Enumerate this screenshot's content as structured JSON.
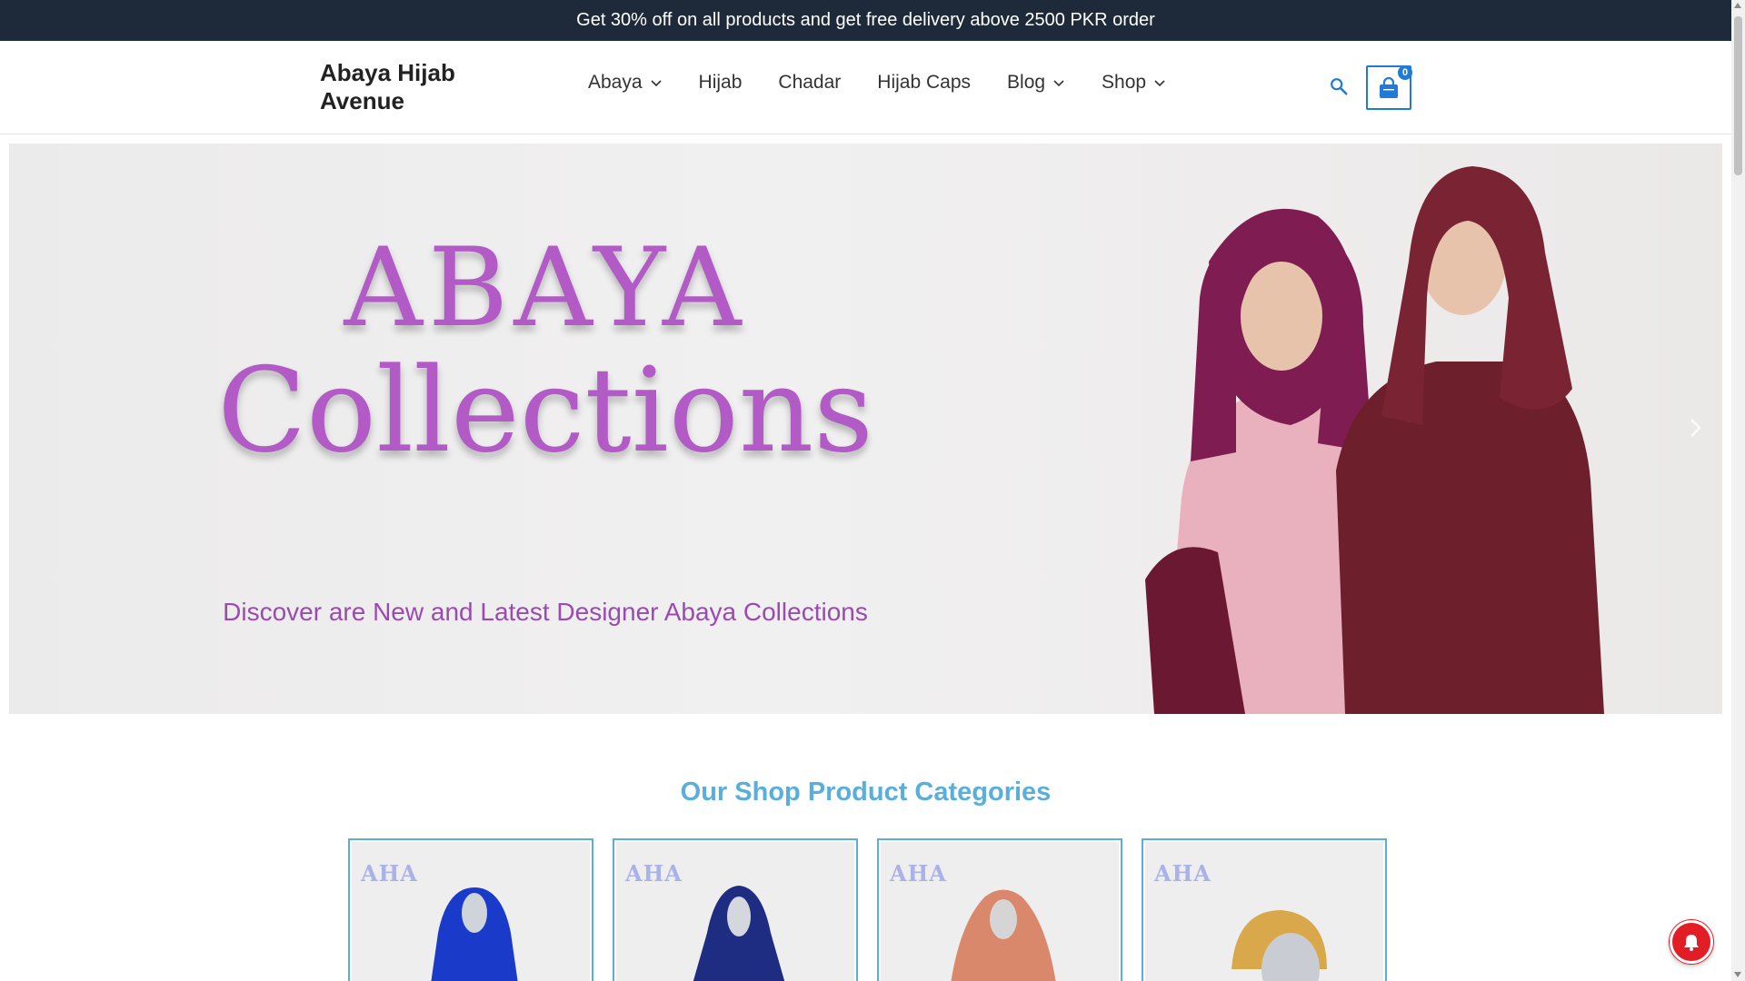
{
  "announcement": "Get 30% off on all products and get free delivery above 2500 PKR order",
  "header": {
    "brand": "Abaya Hijab Avenue",
    "nav": [
      {
        "label": "Abaya",
        "dropdown": true
      },
      {
        "label": "Hijab",
        "dropdown": false
      },
      {
        "label": "Chadar",
        "dropdown": false
      },
      {
        "label": "Hijab Caps",
        "dropdown": false
      },
      {
        "label": "Blog",
        "dropdown": true
      },
      {
        "label": "Shop",
        "dropdown": true
      }
    ],
    "search_icon": "search-icon",
    "cart_icon": "shopping-bag-icon",
    "cart_count": "0"
  },
  "hero": {
    "title_line1": "ABAYA",
    "title_line2": "Collections",
    "subtitle": "Discover are New and Latest Designer Abaya Collections",
    "next_icon": "chevron-right-icon"
  },
  "categories": {
    "title": "Our Shop Product Categories",
    "items": [
      {
        "logo": "AHA",
        "garment_color": "#1a3bc9"
      },
      {
        "logo": "AHA",
        "garment_color": "#1e2d82"
      },
      {
        "logo": "AHA",
        "garment_color": "#d9886b"
      },
      {
        "logo": "AHA",
        "garment_color": "#d8a84a"
      }
    ]
  },
  "chat_widget_icon": "notification-bell-icon",
  "colors": {
    "topbar_bg": "#1e2a3a",
    "accent_blue": "#1e7bd6",
    "section_title": "#5aaedb",
    "hero_purple": "#b25bc7"
  }
}
